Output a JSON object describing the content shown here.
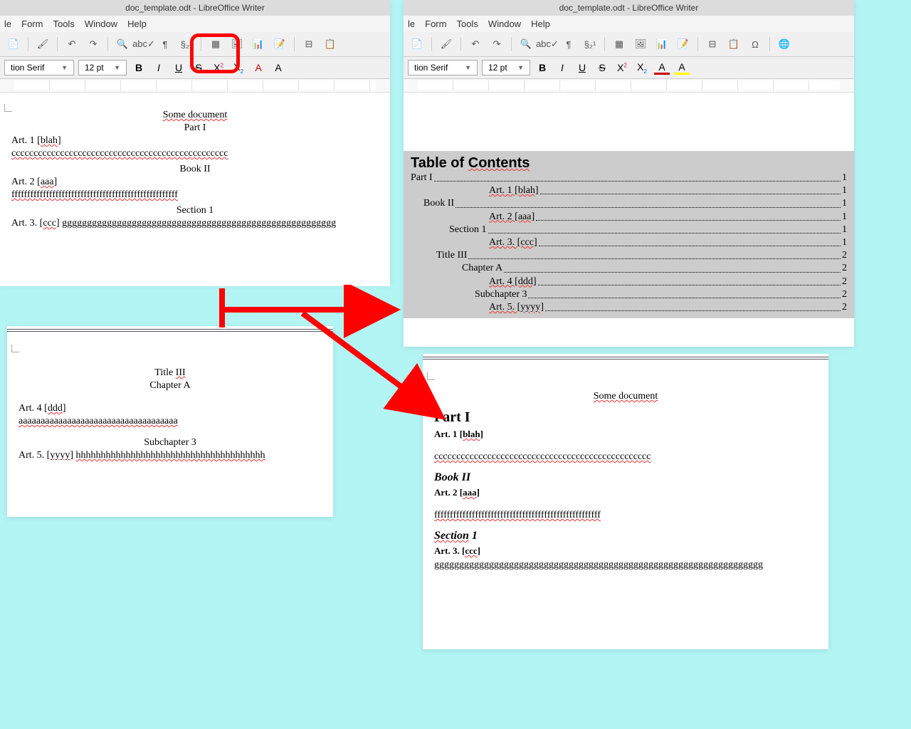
{
  "title": "doc_template.odt - LibreOffice Writer",
  "menus": [
    "le",
    "Form",
    "Tools",
    "Window",
    "Help"
  ],
  "font_name": "tion Serif",
  "font_size": "12 pt",
  "doc_title": "Some document",
  "part1": "Part I",
  "art1": "Art. 1 [blah]",
  "body_c": "ccccccccccccccccccccccccccccccccccccccccccccccccc",
  "book2": "Book II",
  "art2": "Art. 2 [aaa]",
  "body_f": "fffffffffffffffffffffffffffffffffffffffffffffffffffff",
  "section1": "Section 1",
  "art3": "Art. 3.  [ccc]",
  "body_g": "ggggggggggggggggggggggggggggggggggggggggggggggggggggggg",
  "body_gl": "   gggggggggggggggggggggggggggggggggggggggggggggggggggggggggggggggggg",
  "title3": "Title III",
  "chapterA": "Chapter A",
  "art4": "Art. 4 [ddd]",
  "body_a": "aaaaaaaaaaaaaaaaaaaaaaaaaaaaaaaaaaaa",
  "sub3": "Subchapter 3",
  "art5": "Art. 5. [yyyy]",
  "body_h": "hhhhhhhhhhhhhhhhhhhhhhhhhhhhhhhhhhhhhh",
  "toc_title": "Table of Contents",
  "toc": [
    {
      "t": "Part I",
      "p": "1",
      "i": 0,
      "s": false
    },
    {
      "t": "Art. 1 [blah]",
      "p": "1",
      "i": 6,
      "s": true
    },
    {
      "t": "Book II",
      "p": "1",
      "i": 1,
      "s": false
    },
    {
      "t": "Art. 2 [aaa]",
      "p": "1",
      "i": 6,
      "s": true
    },
    {
      "t": "Section 1",
      "p": "1",
      "i": 3,
      "s": false
    },
    {
      "t": "Art. 3. [ccc]",
      "p": "1",
      "i": 6,
      "s": true
    },
    {
      "t": "Title III",
      "p": "2",
      "i": 2,
      "s": false
    },
    {
      "t": "Chapter A",
      "p": "2",
      "i": 4,
      "s": false
    },
    {
      "t": "Art. 4 [ddd]",
      "p": "2",
      "i": 6,
      "s": true
    },
    {
      "t": "Subchapter 3",
      "p": "2",
      "i": 5,
      "s": false
    },
    {
      "t": "Art. 5. [yyyy]",
      "p": "2",
      "i": 6,
      "s": true
    }
  ]
}
